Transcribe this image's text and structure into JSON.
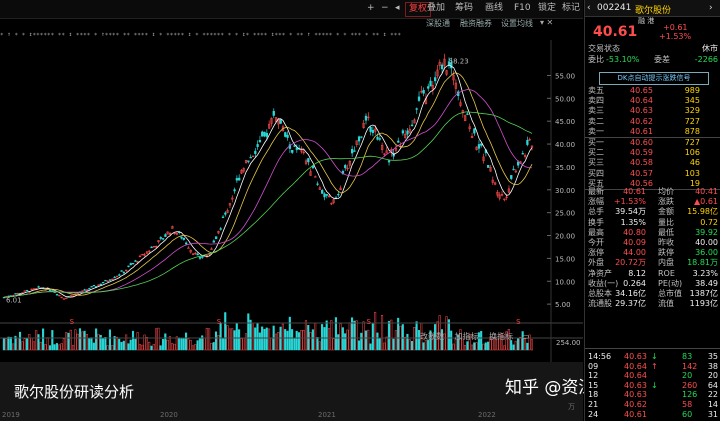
{
  "toolbar": {
    "buttons": [
      "+",
      "−",
      "◂",
      "复权",
      "叠加",
      "筹码",
      "画线",
      "F10",
      "锁定",
      "标记"
    ],
    "sub_buttons": [
      "深股通",
      "融资融券",
      "设置均线"
    ],
    "marker_strip": "∗ ↑ ∗ ∗ ↕∗∗∗∗∗∗ ∗∗ ↕ ∗∗∗∗ ∗ ↑∗∗∗∗ ∗∗ ∗∗∗∗ ↕ ∗ ∗∗∗∗∗ ↕ ∗ ∗∗∗∗∗∗ ∗ ∗ ↕∗ ∗∗∗∗ ↕∗∗∗ ∗ ∗∗ ↑ ∗∗∗∗∗ ∗ ∗ ∗∗∗ ∗ ∗∗ ↕ ∗∗∗"
  },
  "chart": {
    "y_ticks": [
      "55.00",
      "50.00",
      "45.00",
      "40.00",
      "35.00",
      "30.00",
      "25.00",
      "20.00",
      "15.00",
      "10.00",
      "5.00"
    ],
    "peak_label": "58.23",
    "low_label": "6.01",
    "s_markers": [
      "S",
      "S",
      "S",
      "S"
    ],
    "indicator_tabs": [
      "改数数",
      "加指标",
      "换指标"
    ],
    "volume_ticks": [
      "254.00",
      "万"
    ],
    "x_dates": [
      "2019",
      "2020",
      "2021",
      "2022"
    ],
    "colors": {
      "up": "#ff4d4d",
      "down": "#2ad8d8",
      "ma_white": "#ffffff",
      "ma_yellow": "#e6c84a",
      "ma_purple": "#d050d0",
      "ma_green": "#55d055"
    }
  },
  "chart_data": {
    "type": "line",
    "title": "",
    "ylim": [
      5,
      58.23
    ],
    "x": [
      "2019",
      "2020",
      "2021",
      "2022"
    ],
    "series": [
      {
        "name": "",
        "values": [
          6.01,
          10,
          22,
          16,
          45,
          25,
          52,
          58.23,
          28,
          40.61
        ]
      }
    ]
  },
  "panel": {
    "code": "002241",
    "name": "歌尔股份",
    "tags": "融  港",
    "price": "40.61",
    "change": "+0.61",
    "change_pct": "+1.53%",
    "status_label": "交易状态",
    "status": "休市",
    "weibi_label": "委比",
    "weibi": "-53.10%",
    "weicha_label": "委差",
    "weicha": "-2266",
    "dk_label": "DK点自动提示涨跌信号",
    "asks": [
      {
        "label": "卖五",
        "price": "40.65",
        "vol": "989"
      },
      {
        "label": "卖四",
        "price": "40.64",
        "vol": "345"
      },
      {
        "label": "卖三",
        "price": "40.63",
        "vol": "329"
      },
      {
        "label": "卖二",
        "price": "40.62",
        "vol": "727"
      },
      {
        "label": "卖一",
        "price": "40.61",
        "vol": "878"
      }
    ],
    "bids": [
      {
        "label": "买一",
        "price": "40.60",
        "vol": "727"
      },
      {
        "label": "买二",
        "price": "40.59",
        "vol": "106"
      },
      {
        "label": "买三",
        "price": "40.58",
        "vol": "46"
      },
      {
        "label": "买四",
        "price": "40.57",
        "vol": "103"
      },
      {
        "label": "买五",
        "price": "40.56",
        "vol": "19"
      }
    ],
    "stats": [
      {
        "l1": "最新",
        "v1": "40.61",
        "l2": "均价",
        "v2": "40.41",
        "c1": "red",
        "c2": "red"
      },
      {
        "l1": "涨幅",
        "v1": "+1.53%",
        "l2": "涨跌",
        "v2": "▲0.61",
        "c1": "red",
        "c2": "red"
      },
      {
        "l1": "总手",
        "v1": "39.54万",
        "l2": "金额",
        "v2": "15.98亿",
        "c1": "white",
        "c2": "yellow"
      },
      {
        "l1": "换手",
        "v1": "1.35%",
        "l2": "量比",
        "v2": "0.72",
        "c1": "white",
        "c2": "yellow"
      },
      {
        "l1": "最高",
        "v1": "40.80",
        "l2": "最低",
        "v2": "39.92",
        "c1": "red",
        "c2": "green"
      },
      {
        "l1": "今开",
        "v1": "40.09",
        "l2": "昨收",
        "v2": "40.00",
        "c1": "red",
        "c2": "white"
      },
      {
        "l1": "涨停",
        "v1": "44.00",
        "l2": "跌停",
        "v2": "36.00",
        "c1": "red",
        "c2": "green"
      },
      {
        "l1": "外盘",
        "v1": "20.72万",
        "l2": "内盘",
        "v2": "18.81万",
        "c1": "red",
        "c2": "green"
      },
      {
        "l1": "净资产",
        "v1": "8.12",
        "l2": "ROE",
        "v2": "3.23%",
        "c1": "white",
        "c2": "white"
      },
      {
        "l1": "收益(一)",
        "v1": "0.264",
        "l2": "PE(动)",
        "v2": "38.49",
        "c1": "white",
        "c2": "white"
      },
      {
        "l1": "总股本",
        "v1": "34.16亿",
        "l2": "总市值",
        "v2": "1387亿",
        "c1": "white",
        "c2": "white"
      },
      {
        "l1": "流通股",
        "v1": "29.37亿",
        "l2": "流值",
        "v2": "1193亿",
        "c1": "white",
        "c2": "white"
      }
    ],
    "ticks": [
      {
        "t": "14:56",
        "p": "40.63",
        "a": "↓",
        "v": "83",
        "n": "35"
      },
      {
        "t": "09",
        "p": "40.64",
        "a": "↑",
        "v": "142",
        "n": "38"
      },
      {
        "t": "12",
        "p": "40.64",
        "a": "",
        "v": "20",
        "n": "20"
      },
      {
        "t": "15",
        "p": "40.63",
        "a": "↓",
        "v": "260",
        "n": "64"
      },
      {
        "t": "18",
        "p": "40.63",
        "a": "",
        "v": "126",
        "n": "22"
      },
      {
        "t": "21",
        "p": "40.62",
        "a": "",
        "v": "58",
        "n": "14"
      },
      {
        "t": "24",
        "p": "40.61",
        "a": "",
        "v": "60",
        "n": "31"
      }
    ]
  },
  "overlay": {
    "caption": "歌尔股份研读分析",
    "watermark": "知乎 @资深刘经理"
  }
}
